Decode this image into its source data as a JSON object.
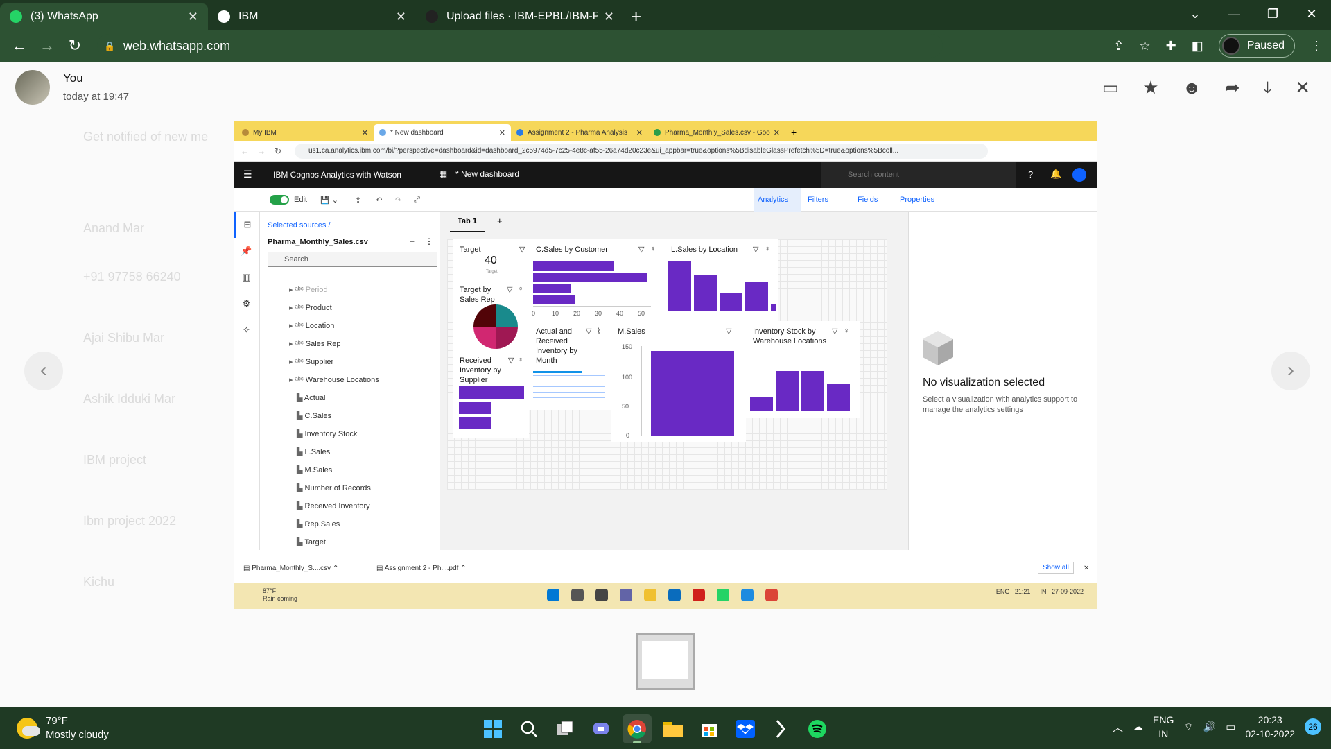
{
  "browser": {
    "tabs": [
      {
        "title": "(3) WhatsApp",
        "color": "#25d366",
        "active": true
      },
      {
        "title": "IBM",
        "color": "#ffffff",
        "active": false
      },
      {
        "title": "Upload files · IBM-EPBL/IBM-Proj",
        "color": "#222222",
        "active": false
      }
    ],
    "url": "web.whatsapp.com",
    "profile_label": "Paused"
  },
  "whatsapp": {
    "sender": "You",
    "time": "today at 19:47",
    "bg_chats": [
      "Get notified of new me",
      "Anand Mar",
      "+91 97758 66240",
      "Ajai Shibu Mar",
      "Ashik Idduki Mar",
      "IBM project",
      "Ibm project 2022",
      "Kichu"
    ]
  },
  "inner": {
    "tabs": [
      {
        "title": "My IBM",
        "active": false
      },
      {
        "title": "* New dashboard",
        "active": true
      },
      {
        "title": "Assignment 2 - Pharma Analysis",
        "active": false
      },
      {
        "title": "Pharma_Monthly_Sales.csv - Goo",
        "active": false
      }
    ],
    "url": "us1.ca.analytics.ibm.com/bi/?perspective=dashboard&id=dashboard_2c5974d5-7c25-4e8c-af55-26a74d20c23e&ui_appbar=true&options%5BdisableGlassPrefetch%5D=true&options%5Bcoll...",
    "app_title": "IBM Cognos Analytics with Watson",
    "dashboard_name": "* New dashboard",
    "search_placeholder": "Search content",
    "toolbar": {
      "edit": "Edit",
      "analytics": "Analytics",
      "filters": "Filters",
      "fields": "Fields",
      "properties": "Properties"
    },
    "panel": {
      "selected_sources": "Selected sources  /",
      "dataset": "Pharma_Monthly_Sales.csv",
      "search": "Search",
      "tree": [
        {
          "label": "Period",
          "kind": "group"
        },
        {
          "label": "Product",
          "kind": "group"
        },
        {
          "label": "Location",
          "kind": "group"
        },
        {
          "label": "Sales Rep",
          "kind": "group"
        },
        {
          "label": "Supplier",
          "kind": "group"
        },
        {
          "label": "Warehouse Locations",
          "kind": "group"
        },
        {
          "label": "Actual",
          "kind": "measure"
        },
        {
          "label": "C.Sales",
          "kind": "measure"
        },
        {
          "label": "Inventory Stock",
          "kind": "measure"
        },
        {
          "label": "L.Sales",
          "kind": "measure"
        },
        {
          "label": "M.Sales",
          "kind": "measure"
        },
        {
          "label": "Number of Records",
          "kind": "measure"
        },
        {
          "label": "Received Inventory",
          "kind": "measure"
        },
        {
          "label": "Rep.Sales",
          "kind": "measure"
        },
        {
          "label": "Target",
          "kind": "measure"
        }
      ]
    },
    "tab1": "Tab 1",
    "cards": {
      "target": {
        "title": "Target",
        "value": "40",
        "sub": "Target"
      },
      "target_by_rep": {
        "title": "Target by Sales Rep"
      },
      "received_by_supplier": {
        "title": "Received Inventory by Supplier"
      },
      "csales_customer": {
        "title": "C.Sales by Customer",
        "axis": [
          "0",
          "10",
          "20",
          "30",
          "40",
          "50"
        ]
      },
      "lsales_location": {
        "title": "L.Sales by Location"
      },
      "actual_received": {
        "title": "Actual and Received Inventory by Month"
      },
      "msales": {
        "title": "M.Sales",
        "axis": [
          "150",
          "100",
          "50",
          "0"
        ]
      },
      "inventory_wh": {
        "title": "Inventory Stock by Warehouse Locations"
      }
    },
    "right_panel": {
      "title": "No visualization selected",
      "subtitle": "Select a visualization with analytics support to manage the analytics settings"
    },
    "downloads": [
      {
        "name": "Pharma_Monthly_S....csv"
      },
      {
        "name": "Assignment 2 - Ph....pdf"
      }
    ],
    "show_all": "Show all",
    "taskbar": {
      "temp": "87°F",
      "weather": "Rain coming",
      "lang1": "ENG",
      "lang2": "IN",
      "time": "21:21",
      "date": "27-09-2022"
    }
  },
  "taskbar": {
    "temp": "79°F",
    "weather": "Mostly cloudy",
    "lang1": "ENG",
    "lang2": "IN",
    "time": "20:23",
    "date": "02-10-2022",
    "notifications": "26"
  },
  "colors": {
    "accent": "#6929c4",
    "ibm_blue": "#0f62fe",
    "chrome_dark": "#1e3822"
  }
}
